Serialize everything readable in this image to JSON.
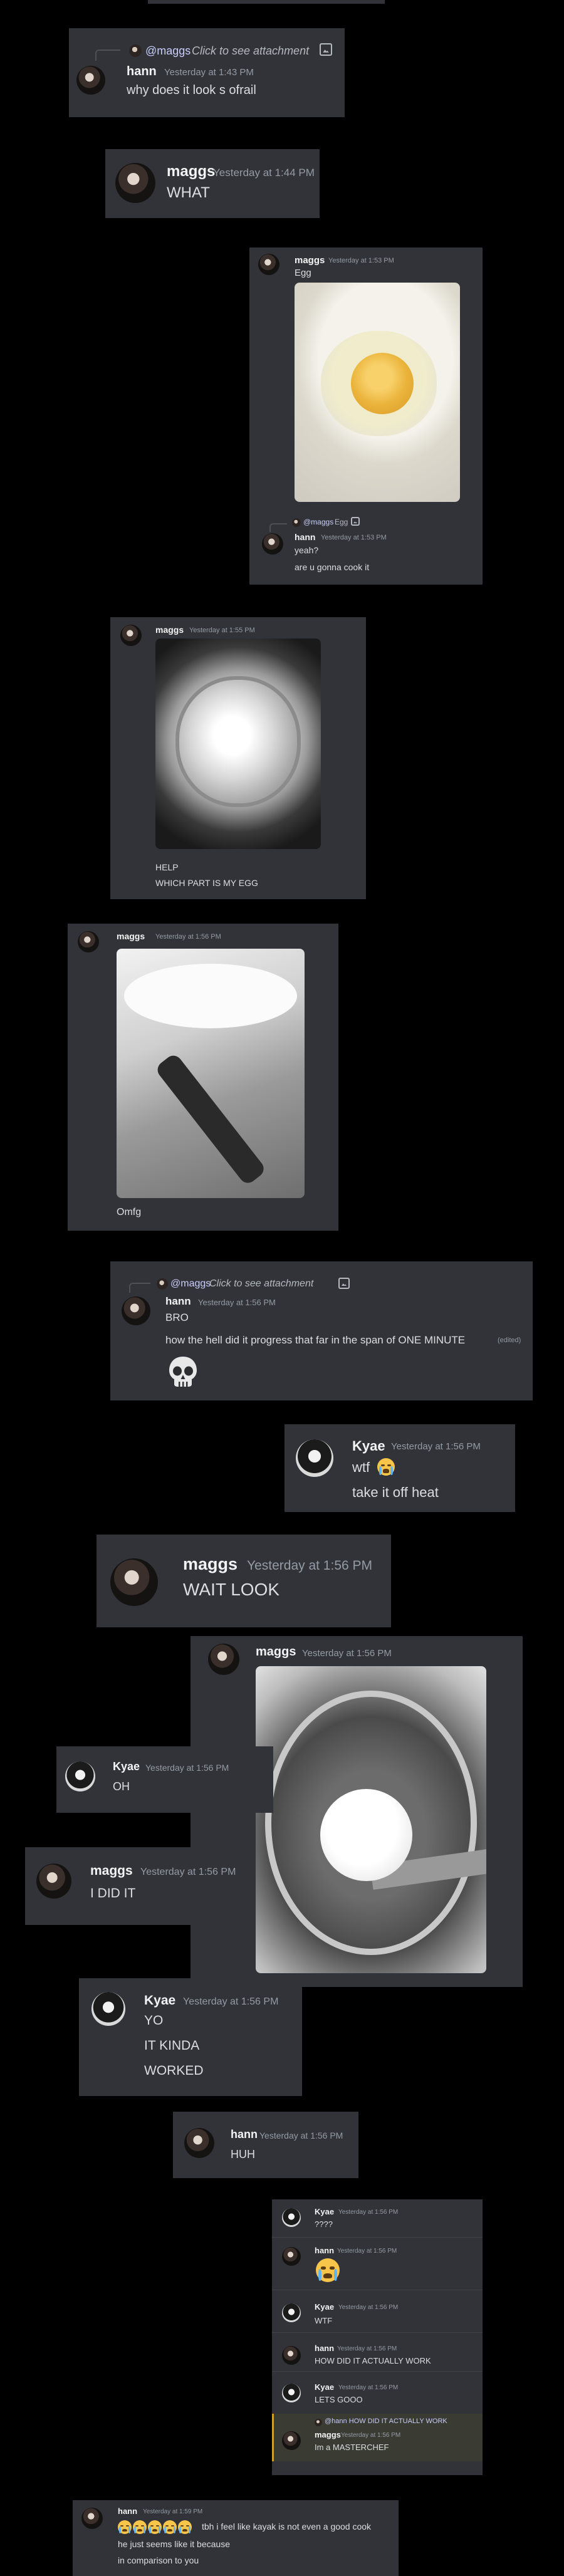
{
  "users": {
    "hann": "hann",
    "maggs": "maggs",
    "kyae": "Kyae"
  },
  "c1": {
    "reply_mention": "@maggs",
    "reply_text": "Click to see attachment",
    "name": "hann",
    "time": "Yesterday at 1:43 PM",
    "text": "why does it look s ofrail"
  },
  "c2": {
    "name": "maggs",
    "time": "Yesterday at 1:44 PM",
    "text": "WHAT"
  },
  "c3": {
    "name": "maggs",
    "time": "Yesterday at 1:53 PM",
    "text": "Egg",
    "reply_mention": "@maggs",
    "reply_text": "Egg",
    "r_name": "hann",
    "r_time": "Yesterday at 1:53 PM",
    "r_text1": "yeah?",
    "r_text2": "are u gonna cook it"
  },
  "c4": {
    "name": "maggs",
    "time": "Yesterday at 1:55 PM",
    "text1": "HELP",
    "text2": "WHICH PART IS MY EGG"
  },
  "c5": {
    "name": "maggs",
    "time": "Yesterday at 1:56 PM",
    "text": "Omfg"
  },
  "c6": {
    "reply_mention": "@maggs",
    "reply_text": "Click to see attachment",
    "name": "hann",
    "time": "Yesterday at 1:56 PM",
    "text1": "BRO",
    "text2": "how the hell did it progress that far in the span of ONE MINUTE",
    "edited": "(edited)",
    "emoji": "skull"
  },
  "c7": {
    "name": "Kyae",
    "time": "Yesterday at 1:56 PM",
    "text1": "wtf",
    "text2": "take it off heat"
  },
  "c8": {
    "name": "maggs",
    "time": "Yesterday at 1:56 PM",
    "text": "WAIT LOOK"
  },
  "c9": {
    "name": "maggs",
    "time": "Yesterday at 1:56 PM"
  },
  "c10": {
    "name": "Kyae",
    "time": "Yesterday at 1:56 PM",
    "text": "OH"
  },
  "c11": {
    "name": "maggs",
    "time": "Yesterday at 1:56 PM",
    "text": "I DID IT"
  },
  "c12": {
    "name": "Kyae",
    "time": "Yesterday at 1:56 PM",
    "text1": "YO",
    "text2": "IT KINDA",
    "text3": "WORKED"
  },
  "c13": {
    "name": "hann",
    "time": "Yesterday at 1:56 PM",
    "text": "HUH"
  },
  "c14": {
    "m1": {
      "name": "Kyae",
      "time": "Yesterday at 1:56 PM",
      "text": "????"
    },
    "m2": {
      "name": "hann",
      "time": "Yesterday at 1:56 PM"
    },
    "m3": {
      "name": "Kyae",
      "time": "Yesterday at 1:56 PM",
      "text": "WTF"
    },
    "m4": {
      "name": "hann",
      "time": "Yesterday at 1:56 PM",
      "text": "HOW DID IT ACTUALLY WORK"
    },
    "m5": {
      "name": "Kyae",
      "time": "Yesterday at 1:56 PM",
      "text": "LETS GOOO"
    },
    "m6": {
      "reply": "@hann HOW DID IT ACTUALLY WORK",
      "name": "maggs",
      "time": "Yesterday at 1:56 PM",
      "text": "Im a MASTERCHEF"
    }
  },
  "c15": {
    "name": "hann",
    "time": "Yesterday at 1:59 PM",
    "text1": "tbh i feel like kayak is not even a good cook",
    "text2": "he just seems like it because",
    "text3": "in comparison to you"
  },
  "icons": {
    "attachment": "image-icon",
    "skull": "skull-emoji",
    "cry": "loudly-crying-emoji"
  }
}
